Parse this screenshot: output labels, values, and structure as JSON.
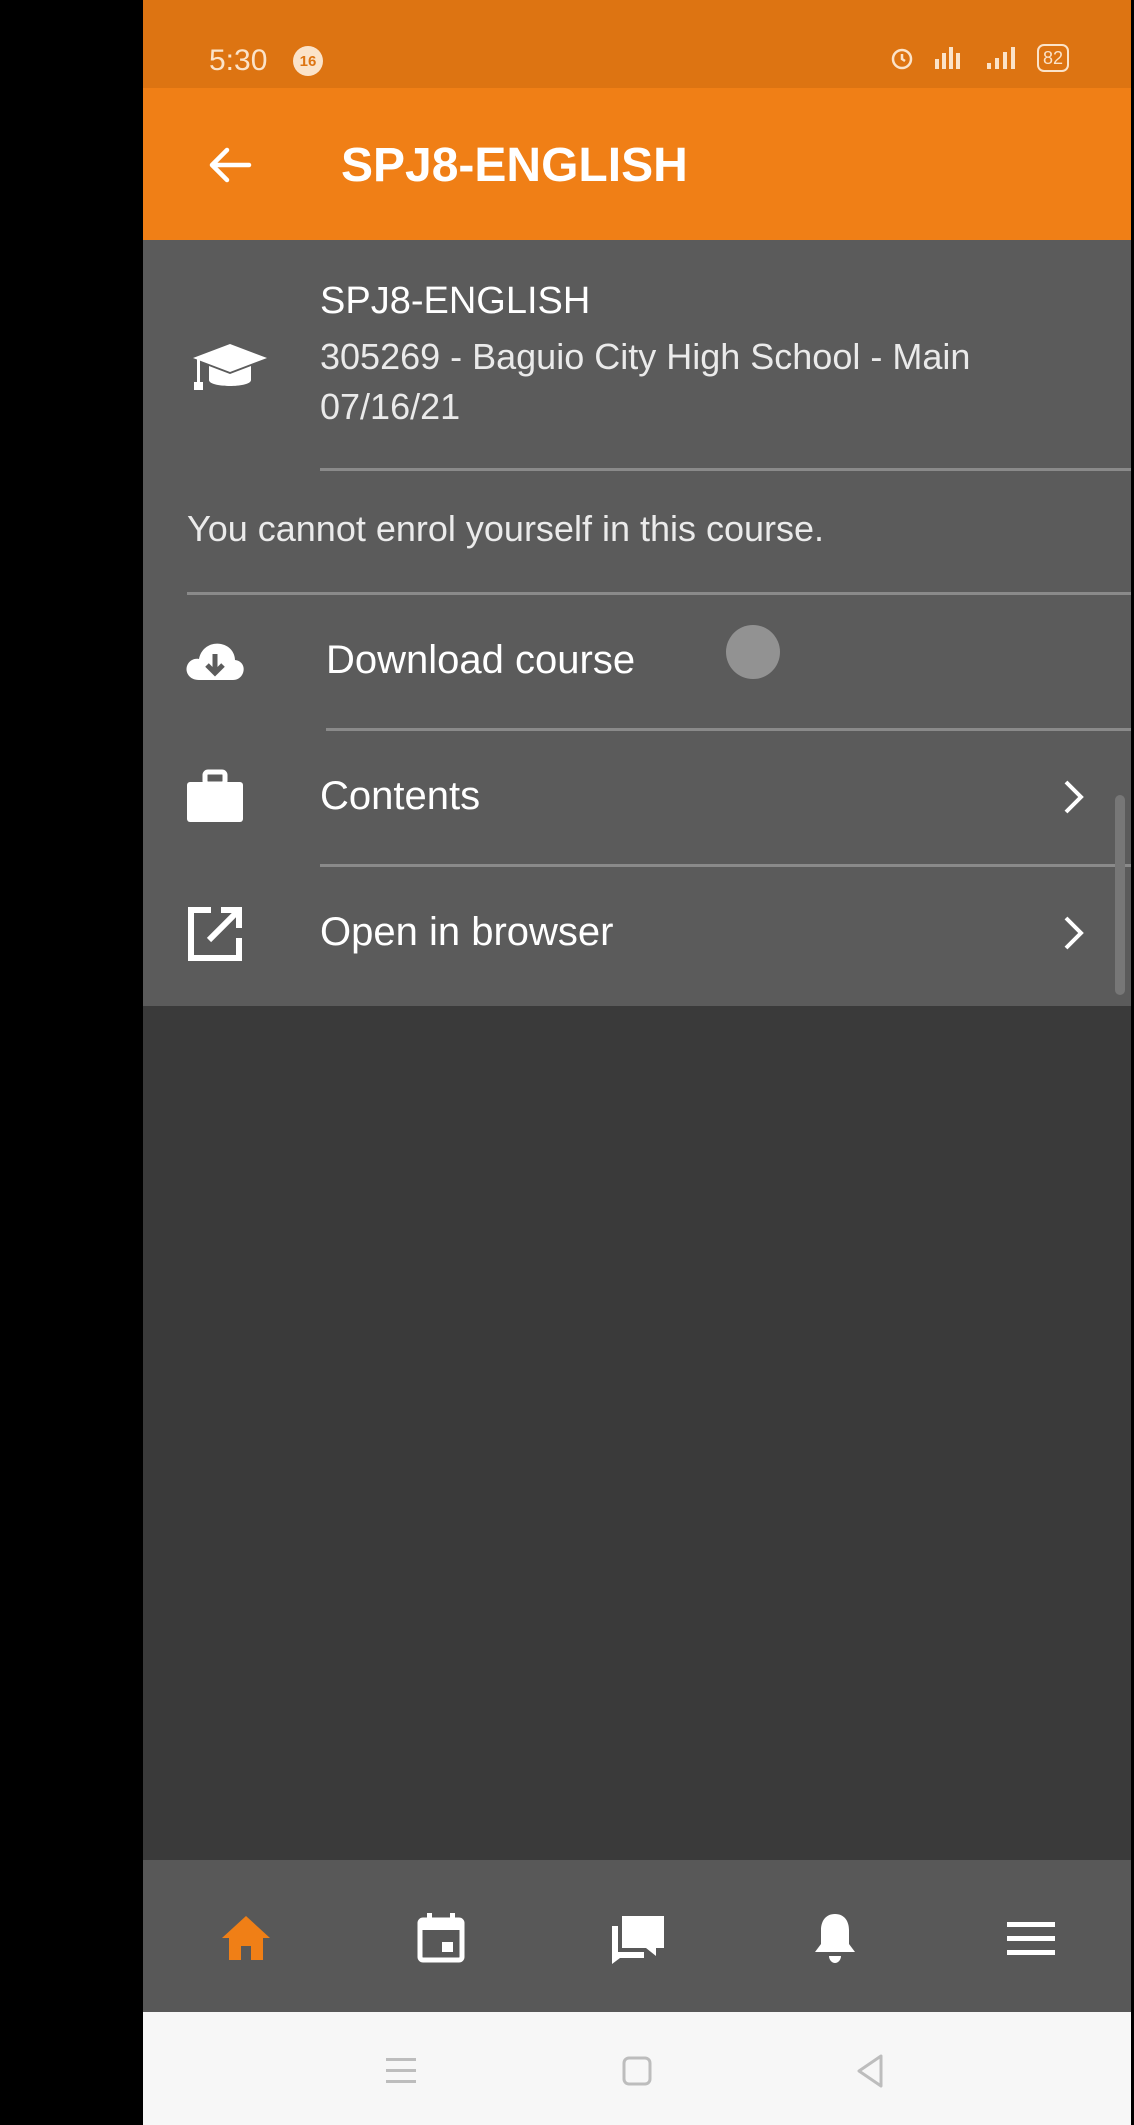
{
  "status_bar": {
    "time": "5:30",
    "notification_count": "16",
    "battery": "82"
  },
  "app_bar": {
    "title": "SPJ8-ENGLISH"
  },
  "course": {
    "name": "SPJ8-ENGLISH",
    "school": "305269 - Baguio City High School - Main",
    "date": "07/16/21"
  },
  "notice": "You cannot enrol yourself in this course.",
  "actions": [
    {
      "label": "Download course",
      "icon": "cloud-download-icon"
    },
    {
      "label": "Contents",
      "icon": "briefcase-icon"
    },
    {
      "label": "Open in browser",
      "icon": "open-external-icon"
    }
  ],
  "bottom_nav": [
    {
      "icon": "home-icon",
      "active": true
    },
    {
      "icon": "calendar-icon",
      "active": false
    },
    {
      "icon": "messages-icon",
      "active": false
    },
    {
      "icon": "bell-icon",
      "active": false
    },
    {
      "icon": "menu-icon",
      "active": false
    }
  ],
  "colors": {
    "accent": "#f07f16",
    "status_bar": "#dd7412",
    "panel": "#5b5b5b",
    "background": "#3a3a3a",
    "nav_active": "#f07f16"
  }
}
